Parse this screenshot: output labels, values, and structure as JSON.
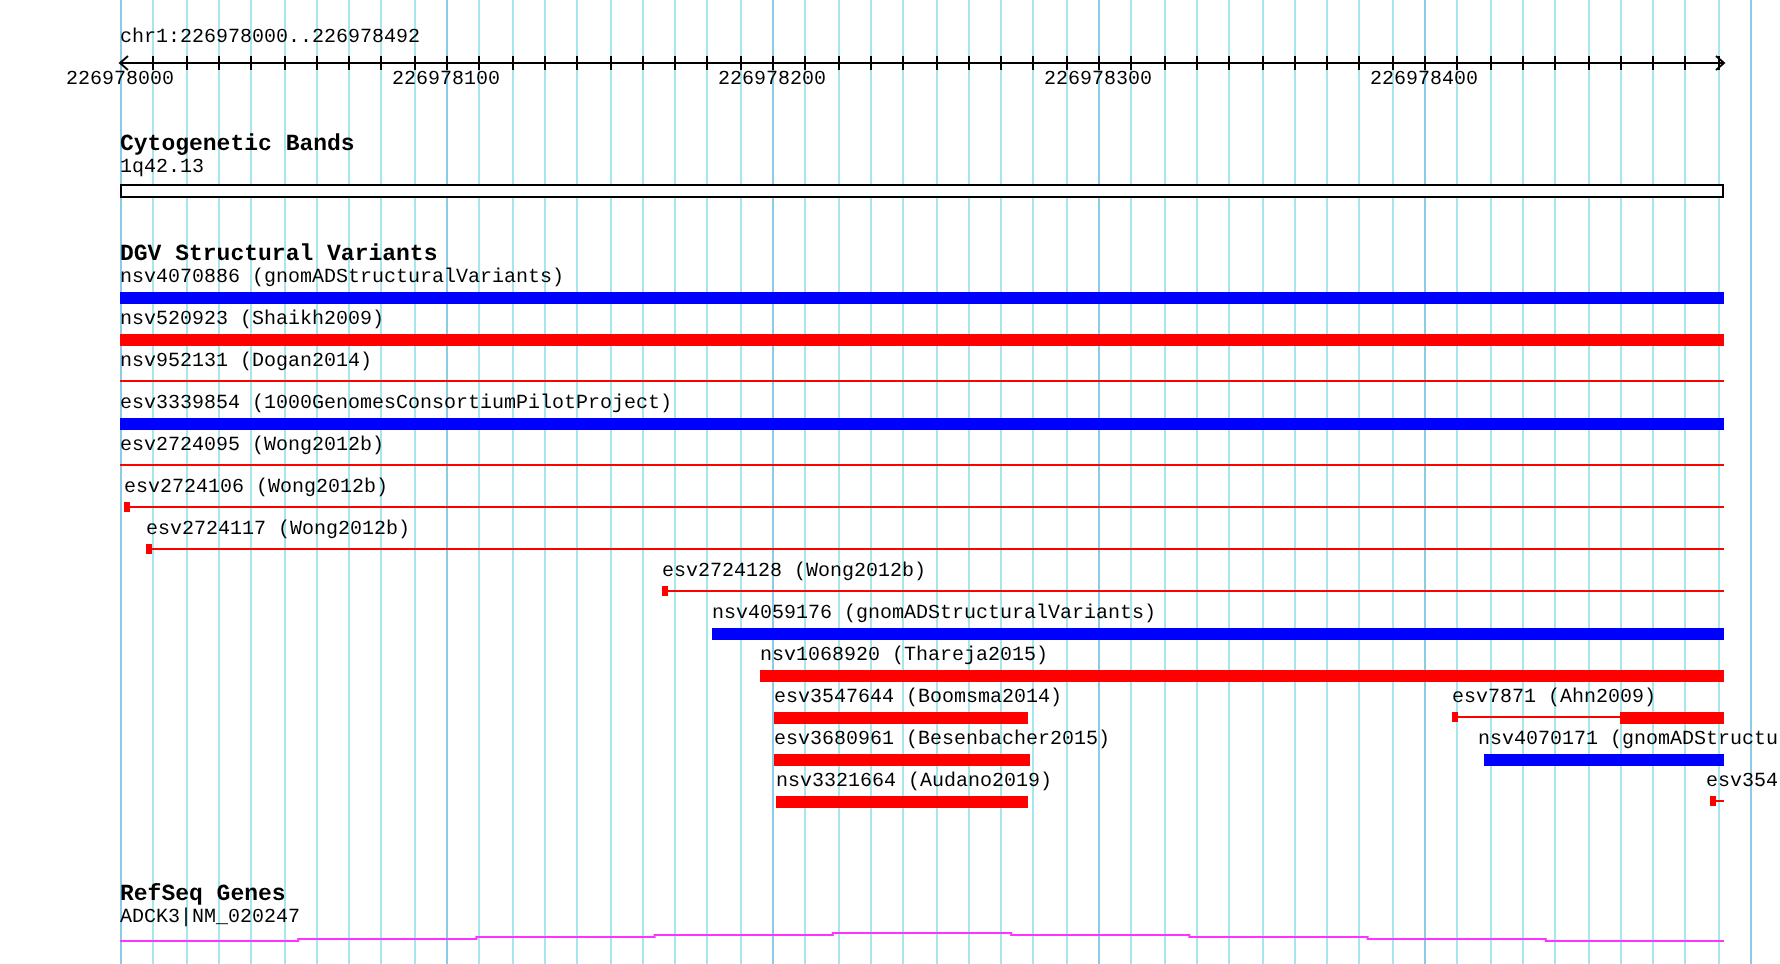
{
  "ruler": {
    "location": "chr1:226978000..226978492",
    "tick_labels": [
      {
        "label": "226978000",
        "level": 0
      },
      {
        "label": "226978100",
        "level": 0.2033
      },
      {
        "label": "226978200",
        "level": 0.4065
      },
      {
        "label": "226978300",
        "level": 0.6098
      },
      {
        "label": "226978400",
        "level": 0.813
      }
    ]
  },
  "tracks": [
    {
      "title": "Cytogenetic Bands",
      "kind": "bands",
      "rows": [
        {
          "features": [
            {
              "label": "1q42.13"
            }
          ]
        }
      ]
    },
    {
      "title": "DGV Structural Variants",
      "kind": "variants",
      "rows": [
        {
          "features": [
            {
              "label": "nsv4070886 (gnomADStructuralVariants)",
              "color": "#0000ff",
              "kind": "thick"
            }
          ]
        },
        {
          "features": [
            {
              "label": "nsv520923 (Shaikh2009)",
              "color": "#ff0000",
              "kind": "thick"
            }
          ]
        },
        {
          "features": [
            {
              "label": "nsv952131 (Dogan2014)",
              "color": "#ff0000",
              "kind": "thin"
            }
          ]
        },
        {
          "features": [
            {
              "label": "esv3339854 (1000GenomesConsortiumPilotProject)",
              "color": "#0000ff",
              "kind": "thick"
            }
          ]
        },
        {
          "features": [
            {
              "label": "esv2724095 (Wong2012b)",
              "color": "#ff0000",
              "kind": "thin"
            }
          ]
        },
        {
          "features": [
            {
              "label": "esv2724106 (Wong2012b)",
              "color": "#ff0000",
              "kind": "tick_thin"
            }
          ]
        },
        {
          "features": [
            {
              "label": "esv2724117 (Wong2012b)",
              "color": "#ff0000",
              "kind": "tick_thin"
            }
          ]
        },
        {
          "features": [
            {
              "label": "esv2724128 (Wong2012b)",
              "color": "#ff0000",
              "kind": "tick_thin"
            }
          ]
        },
        {
          "features": [
            {
              "label": "nsv4059176 (gnomADStructuralVariants)",
              "color": "#0000ff",
              "kind": "thick"
            }
          ]
        },
        {
          "features": [
            {
              "label": "nsv1068920 (Thareja2015)",
              "color": "#ff0000",
              "kind": "thick"
            }
          ]
        },
        {
          "features": [
            {
              "label": "esv3547644 (Boomsma2014)",
              "color": "#ff0000",
              "kind": "thick"
            },
            {
              "label": "esv7871 (Ahn2009)",
              "color": "#ff0000",
              "kind": "tick_thin_thick"
            }
          ]
        },
        {
          "features": [
            {
              "label": "esv3680961 (Besenbacher2015)",
              "color": "#ff0000",
              "kind": "thick"
            },
            {
              "label": "nsv4070171 (gnomADStructu",
              "color": "#0000ff",
              "kind": "thick"
            }
          ]
        },
        {
          "features": [
            {
              "label": "nsv3321664 (Audano2019)",
              "color": "#ff0000",
              "kind": "thick"
            },
            {
              "label": "esv354",
              "color": "#ff0000",
              "kind": "tick_thin"
            }
          ]
        }
      ]
    },
    {
      "title": "RefSeq Genes",
      "kind": "genes",
      "rows": [
        {
          "features": [
            {
              "label": "ADCK3|NM_020247"
            }
          ]
        }
      ]
    }
  ]
}
